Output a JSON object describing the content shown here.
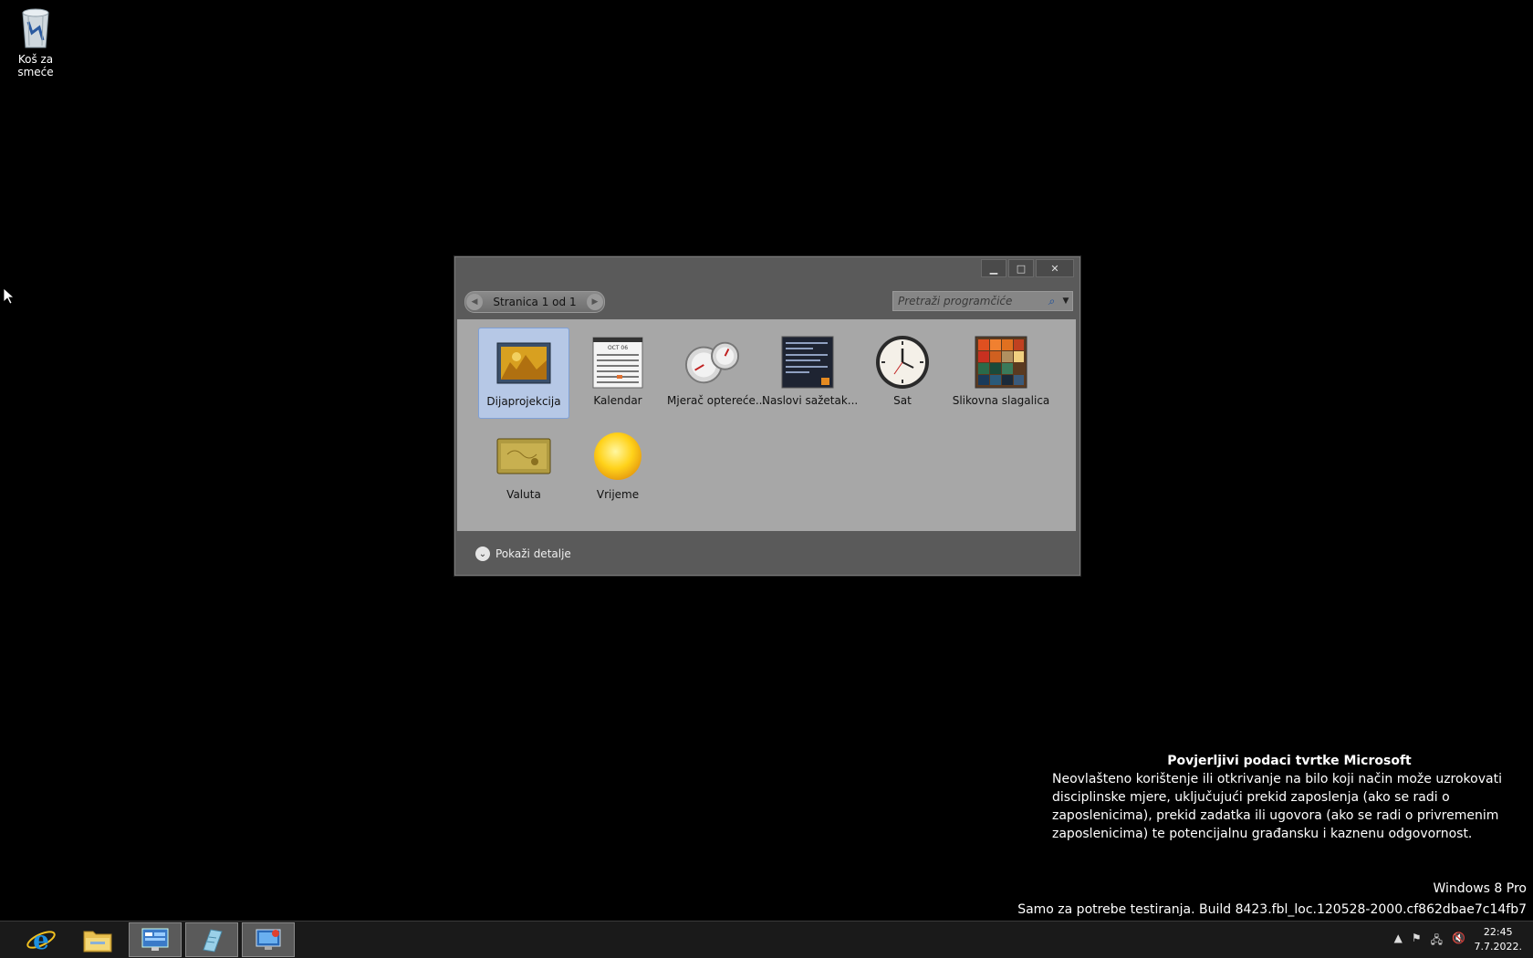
{
  "desktop": {
    "recycle_bin_label": "Koš za smeće"
  },
  "gadgets": {
    "page_label": "Stranica 1 od 1",
    "search_placeholder": "Pretraži programčiće",
    "items": [
      {
        "label": "Dijaprojekcija",
        "icon": "slideshow-icon",
        "selected": true
      },
      {
        "label": "Kalendar",
        "icon": "calendar-icon"
      },
      {
        "label": "Mjerač optereće...",
        "icon": "cpu-meter-icon"
      },
      {
        "label": "Naslovi sažetak...",
        "icon": "feed-headlines-icon"
      },
      {
        "label": "Sat",
        "icon": "clock-icon"
      },
      {
        "label": "Slikovna slagalica",
        "icon": "picture-puzzle-icon"
      },
      {
        "label": "Valuta",
        "icon": "currency-icon"
      },
      {
        "label": "Vrijeme",
        "icon": "weather-icon"
      }
    ],
    "details_label": "Pokaži detalje",
    "calendar_month": "OCT 06"
  },
  "watermark": {
    "title": "Povjerljivi podaci tvrtke Microsoft",
    "body": "Neovlašteno korištenje ili otkrivanje na bilo koji način može uzrokovati disciplinske mjere, uključujući prekid zaposlenja (ako se radi o zaposlenicima), prekid zadatka ili ugovora (ako se radi o privremenim zaposlenicima) te potencijalnu građansku i kaznenu odgovornost.",
    "edition": "Windows 8 Pro",
    "build": "Samo za potrebe testiranja. Build 8423.fbl_loc.120528-2000.cf862dbae7c14fb7"
  },
  "taskbar": {
    "apps": [
      "internet-explorer-icon",
      "file-explorer-icon",
      "server-manager-icon",
      "notepad-icon",
      "remote-desktop-icon"
    ],
    "time": "22:45",
    "date": "7.7.2022."
  },
  "colors": {
    "selected_tile": "#b6c8e6",
    "window_bg": "#5a5a5a",
    "grid_bg": "#a7a7a7"
  }
}
